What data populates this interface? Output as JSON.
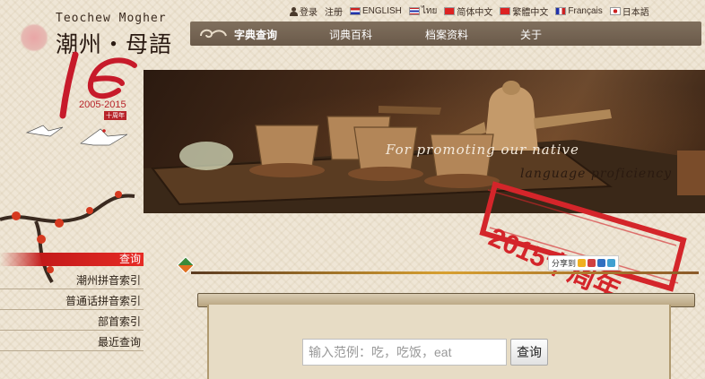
{
  "logo": {
    "latin": "Teochew  Mogher",
    "chinese": "潮州‧母語",
    "anniversary_years": "2005-2015",
    "anniversary_label": "十周年"
  },
  "top_links": {
    "login": "登录",
    "register": "注册",
    "languages": [
      {
        "label": "ENGLISH",
        "flag": "flag-en"
      },
      {
        "label": "ไทย",
        "flag": "flag-th"
      },
      {
        "label": "简体中文",
        "flag": "flag-cn"
      },
      {
        "label": "繁體中文",
        "flag": "flag-hk"
      },
      {
        "label": "Français",
        "flag": "flag-fr"
      },
      {
        "label": "日本語",
        "flag": "flag-jp"
      }
    ]
  },
  "nav": {
    "items": [
      {
        "label": "字典查询",
        "active": true
      },
      {
        "label": "词典百科",
        "active": false
      },
      {
        "label": "档案资料",
        "active": false
      },
      {
        "label": "关于",
        "active": false
      }
    ]
  },
  "banner": {
    "slogan_line1": "For promoting our native",
    "slogan_line2": "language proficiency",
    "stamp_text": "2015十周年"
  },
  "sidebar": {
    "items": [
      {
        "label": "查询",
        "active": true
      },
      {
        "label": "潮州拼音索引",
        "active": false
      },
      {
        "label": "普通话拼音索引",
        "active": false
      },
      {
        "label": "部首索引",
        "active": false
      },
      {
        "label": "最近查询",
        "active": false
      }
    ]
  },
  "share": {
    "label": "分享到"
  },
  "search": {
    "placeholder": "输入范例：吃，吃饭，eat",
    "value": "",
    "button_label": "查询"
  },
  "colors": {
    "accent_red": "#d4252a",
    "nav_bg": "#75644f",
    "page_bg": "#efe6d6"
  }
}
